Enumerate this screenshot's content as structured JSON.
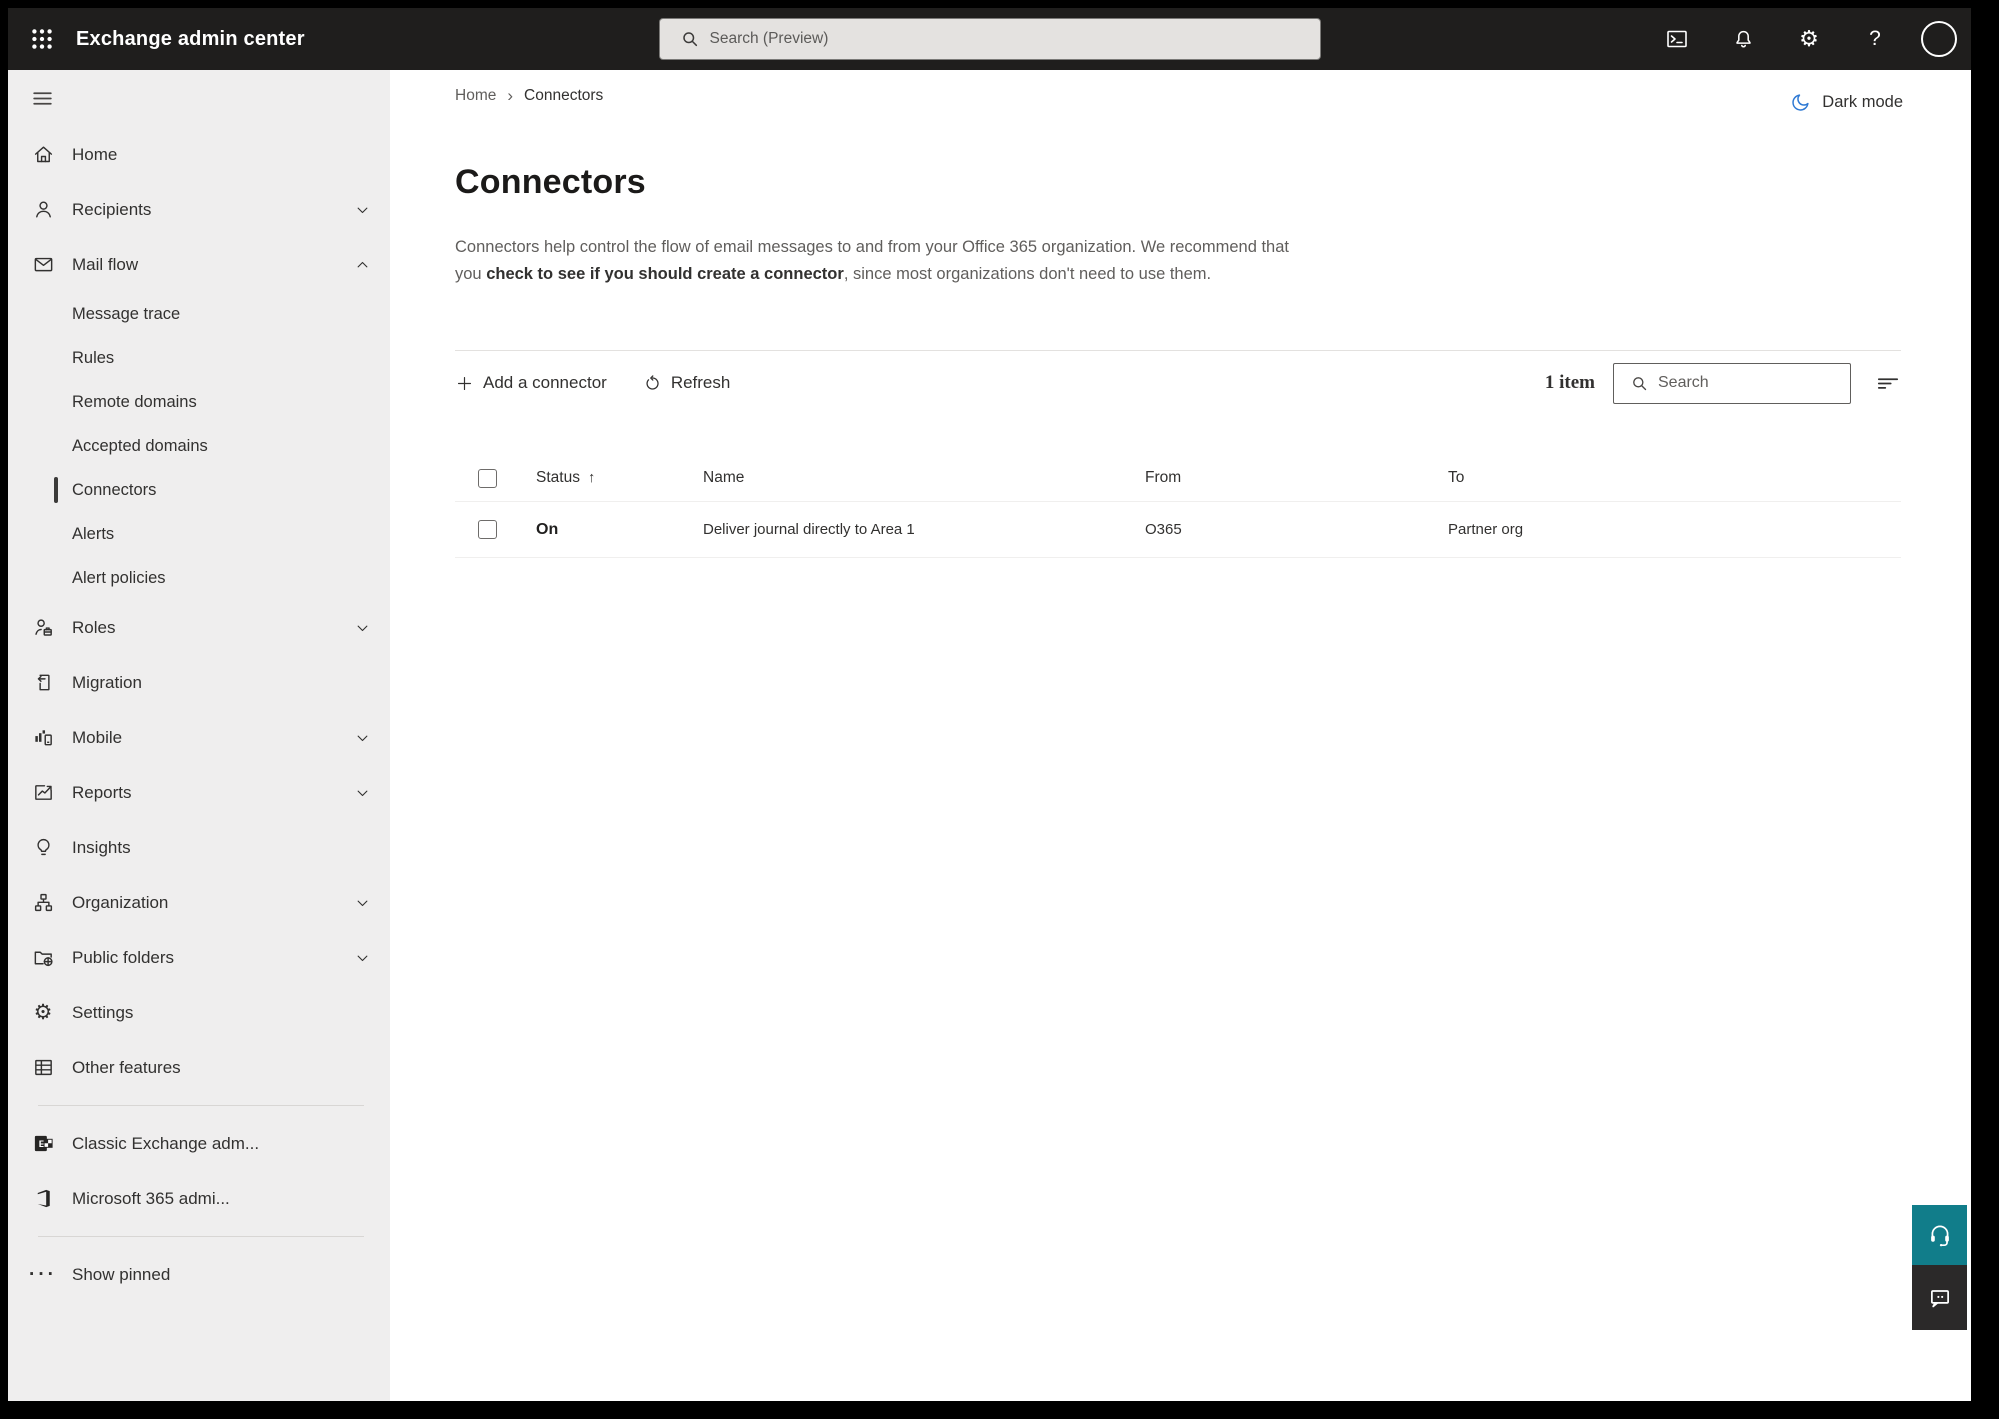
{
  "colors": {
    "topbar_bg": "#1f1e1d",
    "sidebar_bg": "#efeeee",
    "selected_indicator": "#3b3a39",
    "accent_teal": "#117d8a",
    "feedback_dark": "#2b2929",
    "moon_blue": "#2f7ad4",
    "text_primary": "#323130",
    "text_secondary": "#605e5c"
  },
  "topbar": {
    "app_title": "Exchange admin center",
    "search_placeholder": "Search (Preview)"
  },
  "glyphs": {
    "help": "?",
    "gear": "⚙",
    "ellipsis": "···",
    "breadcrumb_separator": "›",
    "sort_asc": "↑"
  },
  "sidebar": {
    "items": [
      {
        "label": "Home"
      },
      {
        "label": "Recipients"
      },
      {
        "label": "Mail flow"
      },
      {
        "label": "Message trace"
      },
      {
        "label": "Rules"
      },
      {
        "label": "Remote domains"
      },
      {
        "label": "Accepted domains"
      },
      {
        "label": "Connectors"
      },
      {
        "label": "Alerts"
      },
      {
        "label": "Alert policies"
      },
      {
        "label": "Roles"
      },
      {
        "label": "Migration"
      },
      {
        "label": "Mobile"
      },
      {
        "label": "Reports"
      },
      {
        "label": "Insights"
      },
      {
        "label": "Organization"
      },
      {
        "label": "Public folders"
      },
      {
        "label": "Settings"
      },
      {
        "label": "Other features"
      },
      {
        "label": "Classic Exchange adm..."
      },
      {
        "label": "Microsoft 365 admi..."
      },
      {
        "label": "Show pinned"
      }
    ]
  },
  "breadcrumb": {
    "home": "Home",
    "current": "Connectors"
  },
  "header": {
    "dark_mode_label": "Dark mode"
  },
  "page": {
    "title": "Connectors",
    "desc_before": "Connectors help control the flow of email messages to and from your Office 365 organization. We recommend that you ",
    "desc_emphasis": "check to see if you should create a connector",
    "desc_after": ", since most organizations don't need to use them."
  },
  "toolbar": {
    "add_label": "Add a connector",
    "refresh_label": "Refresh",
    "item_count": "1 item",
    "search_placeholder": "Search"
  },
  "table": {
    "columns": {
      "status": "Status",
      "name": "Name",
      "from": "From",
      "to": "To"
    },
    "rows": [
      {
        "status": "On",
        "name": "Deliver journal directly to Area 1",
        "from": "O365",
        "to": "Partner org"
      }
    ]
  }
}
